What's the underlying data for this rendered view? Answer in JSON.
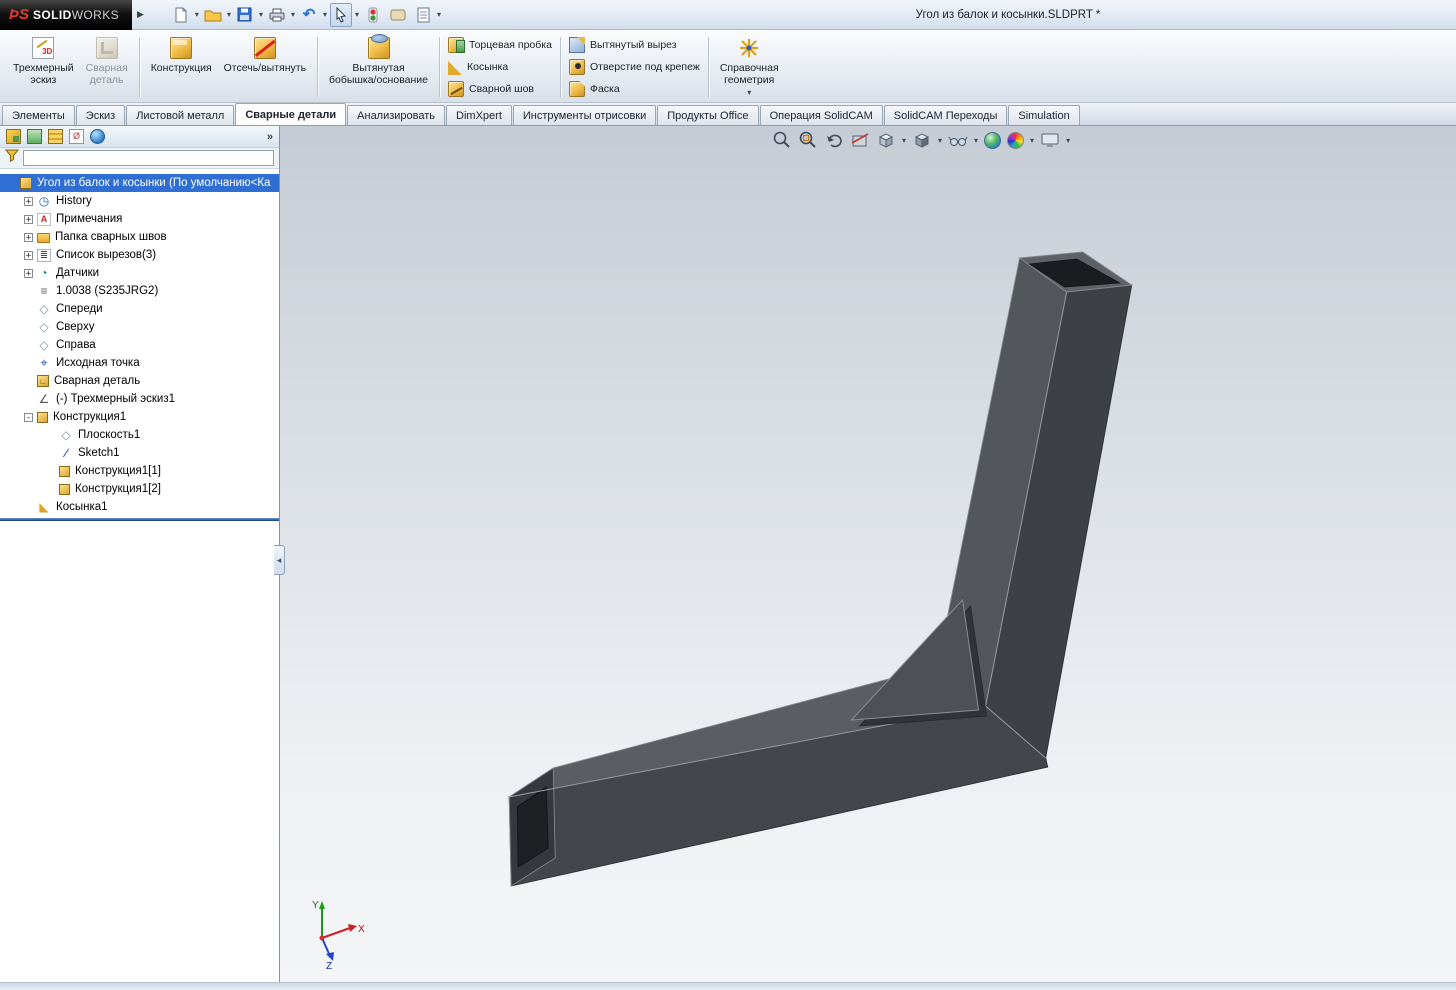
{
  "colors": {
    "selection_blue": "#2f6fd4",
    "brand_red": "#e8382e",
    "rollback_blue": "#123a7a",
    "model_dark": "#3d4145",
    "viewport_top": "#c6ccd5"
  },
  "titlebar": {
    "brand_logo": "ϷS",
    "brand_bold": "SOLID",
    "brand_light": "WORKS",
    "title": "Угол из балок и косынки.SLDPRT *"
  },
  "quick_access": {
    "icons": [
      "new-document-icon",
      "open-icon",
      "save-icon",
      "print-icon",
      "undo-icon",
      "select-cursor-icon",
      "rebuild-icon",
      "options-icon",
      "file-properties-icon"
    ]
  },
  "ribbon": {
    "large_buttons": [
      {
        "line1": "Трехмерный",
        "line2": "эскиз",
        "icon": "3d-sketch-icon",
        "enabled": true
      },
      {
        "line1": "Сварная",
        "line2": "деталь",
        "icon": "weldment-icon",
        "enabled": false
      },
      {
        "line1": "Конструкция",
        "line2": "",
        "icon": "structural-member-icon",
        "enabled": true
      },
      {
        "line1": "Отсечь/вытянуть",
        "line2": "",
        "icon": "trim-extend-icon",
        "enabled": true
      },
      {
        "line1": "Вытянутая",
        "line2": "бобышка/основание",
        "icon": "extruded-boss-icon",
        "enabled": true
      },
      {
        "line1": "Справочная",
        "line2": "геометрия",
        "icon": "reference-geometry-icon",
        "enabled": true,
        "has_dropdown": true
      }
    ],
    "small1": [
      {
        "label": "Торцевая пробка",
        "icon": "end-cap-icon"
      },
      {
        "label": "Косынка",
        "icon": "gusset-icon"
      },
      {
        "label": "Сварной шов",
        "icon": "weld-bead-icon"
      }
    ],
    "small2": [
      {
        "label": "Вытянутый вырез",
        "icon": "extruded-cut-icon"
      },
      {
        "label": "Отверстие под крепеж",
        "icon": "hole-wizard-icon"
      },
      {
        "label": "Фаска",
        "icon": "chamfer-icon"
      }
    ]
  },
  "tabs": {
    "active": "Сварные детали",
    "items": [
      {
        "label": "Элементы"
      },
      {
        "label": "Эскиз"
      },
      {
        "label": "Листовой металл"
      },
      {
        "label": "Сварные детали"
      },
      {
        "label": "Анализировать"
      },
      {
        "label": "DimXpert"
      },
      {
        "label": "Инструменты отрисовки"
      },
      {
        "label": "Продукты Office"
      },
      {
        "label": "Операция  SolidCAM"
      },
      {
        "label": "SolidCAM Переходы"
      },
      {
        "label": "Simulation"
      }
    ]
  },
  "panel": {
    "toolbar_icons": [
      "featuremanager-tab-icon",
      "propertymanager-tab-icon",
      "configurationmanager-tab-icon",
      "dimxpertmanager-tab-icon",
      "displaymanager-tab-icon"
    ],
    "collapse_chevron": "»",
    "filter": {
      "value": "",
      "icon": "filter-funnel-icon"
    },
    "tree": {
      "root": {
        "label": "Угол из балок и косынки  (По умолчанию<Ка",
        "icon": "part-icon",
        "selected": true
      },
      "items": [
        {
          "label": "History",
          "expander": "+",
          "icon": "history-icon"
        },
        {
          "label": "Примечания",
          "expander": "+",
          "icon": "annotations-icon"
        },
        {
          "label": "Папка сварных швов",
          "expander": "+",
          "icon": "weld-folder-icon"
        },
        {
          "label": "Список вырезов(3)",
          "expander": "+",
          "icon": "cut-list-icon"
        },
        {
          "label": "Датчики",
          "expander": "+",
          "icon": "sensors-icon"
        },
        {
          "label": "1.0038 (S235JRG2)",
          "expander": "",
          "icon": "material-icon"
        },
        {
          "label": "Спереди",
          "expander": "",
          "icon": "plane-icon"
        },
        {
          "label": "Сверху",
          "expander": "",
          "icon": "plane-icon"
        },
        {
          "label": "Справа",
          "expander": "",
          "icon": "plane-icon"
        },
        {
          "label": "Исходная точка",
          "expander": "",
          "icon": "origin-icon"
        },
        {
          "label": "Сварная деталь",
          "expander": "",
          "icon": "weldment-feature-icon"
        },
        {
          "label": "(-) Трехмерный эскиз1",
          "expander": "",
          "icon": "3d-sketch-icon"
        },
        {
          "label": "Конструкция1",
          "expander": "-",
          "icon": "structural-member-icon"
        },
        {
          "label": "Плоскость1",
          "expander": "",
          "icon": "plane-icon",
          "child": true
        },
        {
          "label": "Sketch1",
          "expander": "",
          "icon": "sketch-icon",
          "child": true
        },
        {
          "label": "Конструкция1[1]",
          "expander": "",
          "icon": "structural-member-icon",
          "child": true
        },
        {
          "label": "Конструкция1[2]",
          "expander": "",
          "icon": "structural-member-icon",
          "child": true
        },
        {
          "label": "Косынка1",
          "expander": "",
          "icon": "gusset-icon"
        }
      ]
    }
  },
  "viewport": {
    "hud_icons": [
      "zoom-to-fit-icon",
      "zoom-to-area-icon",
      "previous-view-icon",
      "section-view-icon",
      "view-orientation-icon",
      "display-style-icon",
      "hide-show-items-icon",
      "edit-appearance-icon",
      "apply-scene-icon",
      "view-settings-icon"
    ],
    "triad": {
      "x_label": "X",
      "y_label": "Y",
      "z_label": "Z"
    },
    "model_name": "Угол из балок и косынки"
  }
}
